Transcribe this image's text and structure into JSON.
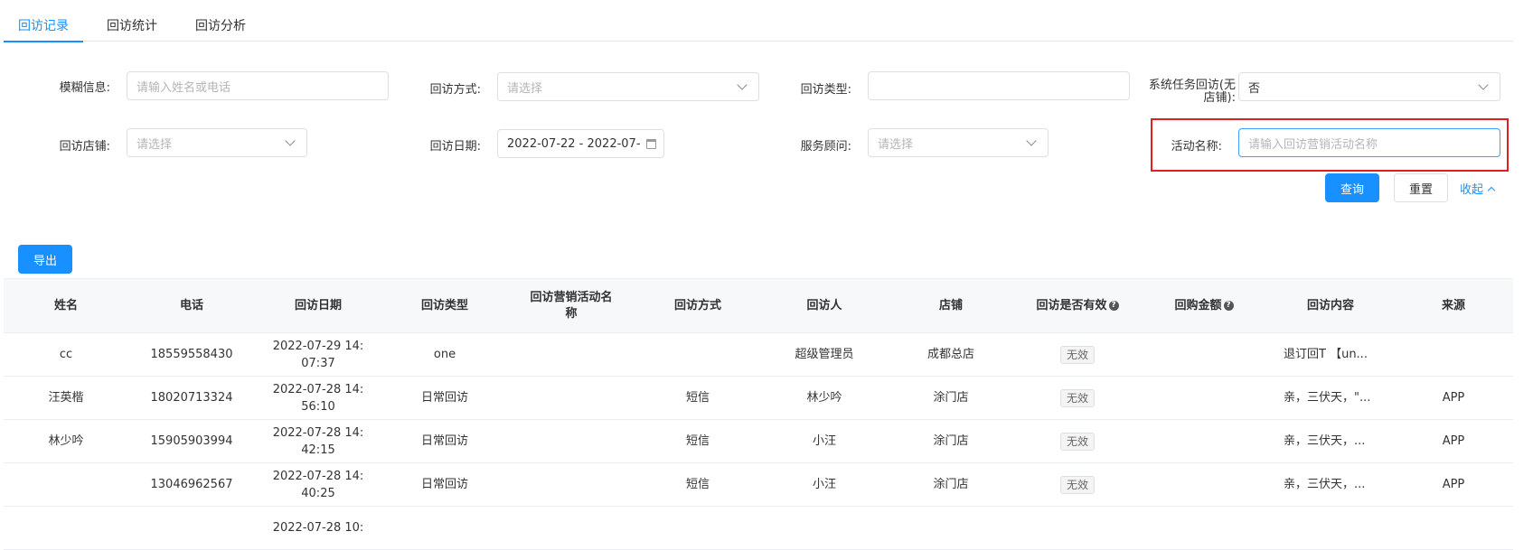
{
  "tabs": [
    {
      "label": "回访记录",
      "active": true
    },
    {
      "label": "回访统计",
      "active": false
    },
    {
      "label": "回访分析",
      "active": false
    }
  ],
  "filters": {
    "fuzzy": {
      "label": "模糊信息:",
      "placeholder": "请输入姓名或电话"
    },
    "method": {
      "label": "回访方式:",
      "placeholder": "请选择"
    },
    "type": {
      "label": "回访类型:",
      "value": ""
    },
    "system_task": {
      "label_line1": "系统任务回访(无",
      "label_line2": "店铺):",
      "value": "否"
    },
    "store": {
      "label": "回访店铺:",
      "placeholder": "请选择"
    },
    "date": {
      "label": "回访日期:",
      "value": "2022-07-22 - 2022-07-"
    },
    "advisor": {
      "label": "服务顾问:",
      "placeholder": "请选择"
    },
    "activity": {
      "label": "活动名称:",
      "placeholder": "请输入回访营销活动名称"
    }
  },
  "actions": {
    "query": "查询",
    "reset": "重置",
    "collapse": "收起",
    "export": "导出"
  },
  "table": {
    "headers": [
      "姓名",
      "电话",
      "回访日期",
      "回访类型",
      "回访营销活动名称",
      "回访方式",
      "回访人",
      "店铺",
      "回访是否有效",
      "回购金额",
      "回访内容",
      "来源"
    ],
    "help_icon": "?",
    "rows": [
      {
        "name": "cc",
        "phone": "18559558430",
        "date1": "2022-07-29 14:",
        "date2": "07:37",
        "type": "one",
        "activity": "",
        "method": "",
        "visitor": "超级管理员",
        "store": "成都总店",
        "valid": "无效",
        "amount": "",
        "content": "退订回T 【un...",
        "source": ""
      },
      {
        "name": "汪英楷",
        "phone": "18020713324",
        "date1": "2022-07-28 14:",
        "date2": "56:10",
        "type": "日常回访",
        "activity": "",
        "method": "短信",
        "visitor": "林少吟",
        "store": "涂门店",
        "valid": "无效",
        "amount": "",
        "content": "亲，三伏天，\"...",
        "source": "APP"
      },
      {
        "name": "林少吟",
        "phone": "15905903994",
        "date1": "2022-07-28 14:",
        "date2": "42:15",
        "type": "日常回访",
        "activity": "",
        "method": "短信",
        "visitor": "小汪",
        "store": "涂门店",
        "valid": "无效",
        "amount": "",
        "content": "亲，三伏天，...",
        "source": "APP"
      },
      {
        "name": "",
        "phone": "13046962567",
        "date1": "2022-07-28 14:",
        "date2": "40:25",
        "type": "日常回访",
        "activity": "",
        "method": "短信",
        "visitor": "小汪",
        "store": "涂门店",
        "valid": "无效",
        "amount": "",
        "content": "亲，三伏天，...",
        "source": "APP"
      },
      {
        "name": "",
        "phone": "",
        "date1": "2022-07-28 10:",
        "date2": "",
        "type": "",
        "activity": "",
        "method": "",
        "visitor": "",
        "store": "",
        "valid": "",
        "amount": "",
        "content": "",
        "source": ""
      }
    ]
  },
  "colors": {
    "primary": "#1890ff",
    "highlight": "#e02020"
  }
}
